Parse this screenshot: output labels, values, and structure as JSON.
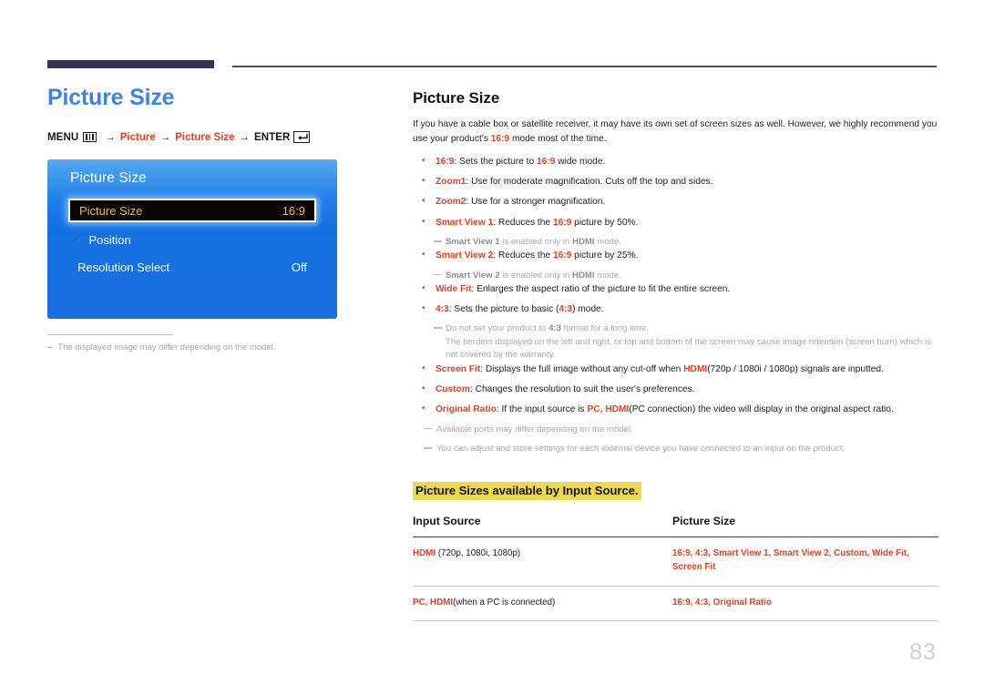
{
  "header": {
    "rule_color": "#333354"
  },
  "left": {
    "title": "Picture Size",
    "breadcrumb": {
      "menu_label": "MENU",
      "menu_icon": "menu-bars-icon",
      "arrow": "→",
      "step1": "Picture",
      "step2": "Picture Size",
      "enter_label": "ENTER",
      "enter_icon": "enter-return-icon"
    },
    "osd": {
      "title": "Picture Size",
      "rows": [
        {
          "label": "Picture Size",
          "value": "16:9",
          "selected": true
        },
        {
          "label": "Position",
          "value": "",
          "selected": false,
          "dot": "·"
        },
        {
          "label": "Resolution Select",
          "value": "Off",
          "selected": false
        }
      ]
    },
    "note": {
      "dash": "–",
      "text": "The displayed image may differ depending on the model."
    }
  },
  "right": {
    "title": "Picture Size",
    "intro": "If you have a cable box or satellite receiver, it may have its own set of screen sizes as well. However, we highly recommend you use your product's 16:9 mode most of the time.",
    "bullets": [
      {
        "term": "16:9",
        "rest_before": ": Sets the picture to ",
        "inline_red": "16:9",
        "rest_after": " wide mode.",
        "subnotes": []
      },
      {
        "term": "Zoom1",
        "rest_before": ": Use for moderate magnification. Cuts off the top and sides.",
        "inline_red": "",
        "rest_after": "",
        "subnotes": []
      },
      {
        "term": "Zoom2",
        "rest_before": ": Use for a stronger magnification.",
        "inline_red": "",
        "rest_after": "",
        "subnotes": []
      },
      {
        "term": "Smart View 1",
        "rest_before": ": Reduces the ",
        "inline_red": "16:9",
        "rest_after": " picture by 50%.",
        "subnotes": [
          {
            "lead": "Smart View 1",
            "mid": " is enabled only in ",
            "strong": "HDMI",
            "tail": " mode."
          }
        ]
      },
      {
        "term": "Smart View 2",
        "rest_before": ": Reduces the ",
        "inline_red": "16:9",
        "rest_after": " picture by 25%.",
        "subnotes": [
          {
            "lead": "Smart View 2",
            "mid": " is enabled only in ",
            "strong": "HDMI",
            "tail": " mode."
          }
        ]
      },
      {
        "term": "Wide Fit",
        "rest_before": ": Enlarges the aspect ratio of the picture to fit the entire screen.",
        "inline_red": "",
        "rest_after": "",
        "subnotes": []
      },
      {
        "term": "4:3",
        "rest_before": ": Sets the picture to basic (",
        "inline_red": "4:3",
        "rest_after": ") mode.",
        "subnotes": [
          {
            "lead": "",
            "mid": "Do not set your product to ",
            "strong": "4:3",
            "tail": " format for a long time.",
            "cont": "The borders displayed on the left and right, or top and bottom of the screen may cause image retention (screen burn) which is not covered by the warranty."
          }
        ]
      },
      {
        "term": "Screen Fit",
        "rest_before": ": Displays the full image without any cut-off when ",
        "inline_red": "HDMI",
        "rest_after": "(720p / 1080i / 1080p) signals are inputted.",
        "subnotes": []
      },
      {
        "term": "Custom",
        "rest_before": ": Changes the resolution to suit the user's preferences.",
        "inline_red": "",
        "rest_after": "",
        "subnotes": []
      },
      {
        "term": "Original Ratio",
        "rest_before": ": If the input source is ",
        "inline_red": "PC, HDMI",
        "rest_after": "(PC connection) the video will display in the original aspect ratio.",
        "subnotes": []
      }
    ],
    "trailing_notes": [
      "Available ports may differ depending on the model.",
      "You can adjust and store settings for each external device you have connected to an input on the product."
    ],
    "section_heading": "Picture Sizes available by Input Source.",
    "table": {
      "headers": [
        "Input Source",
        "Picture Size"
      ],
      "rows": [
        {
          "source_strong": "HDMI",
          "source_plain": " (720p, 1080i, 1080p)",
          "sizes": "16:9, 4:3, Smart View 1, Smart View 2, Custom, Wide Fit, Screen Fit"
        },
        {
          "source_strong": "PC, HDMI",
          "source_plain": "(when a PC is connected)",
          "sizes": "16:9, 4:3, Original Ratio"
        }
      ]
    }
  },
  "footer": {
    "page_number": "83"
  }
}
